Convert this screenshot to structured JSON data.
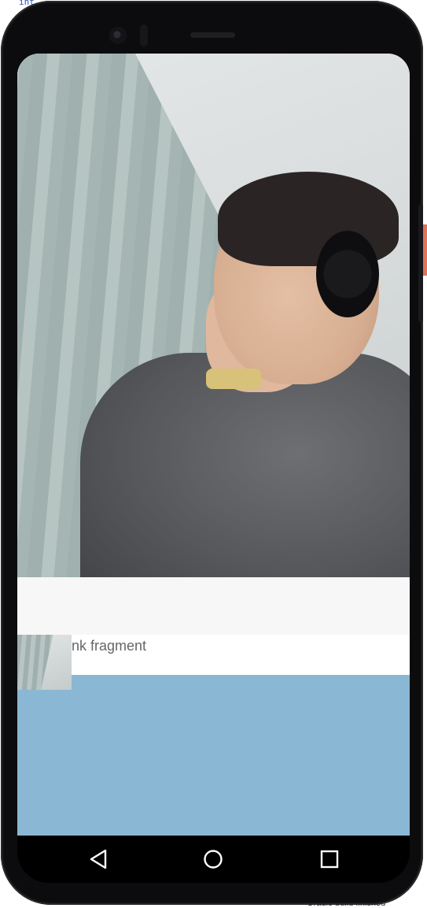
{
  "background_ide": {
    "top_fragment": "int",
    "bottom_fragment": "Gradle build finished"
  },
  "app": {
    "video_label": "remote-camera-view",
    "fragment_label": "nk fragment"
  },
  "navigation_bar": {
    "back": "back-icon",
    "home": "home-icon",
    "recents": "recents-icon"
  },
  "colors": {
    "blue_panel": "#8ab7d4",
    "gray_bar": "#f7f7f7",
    "label_text": "#666666",
    "device_frame": "#0c0c0e"
  }
}
